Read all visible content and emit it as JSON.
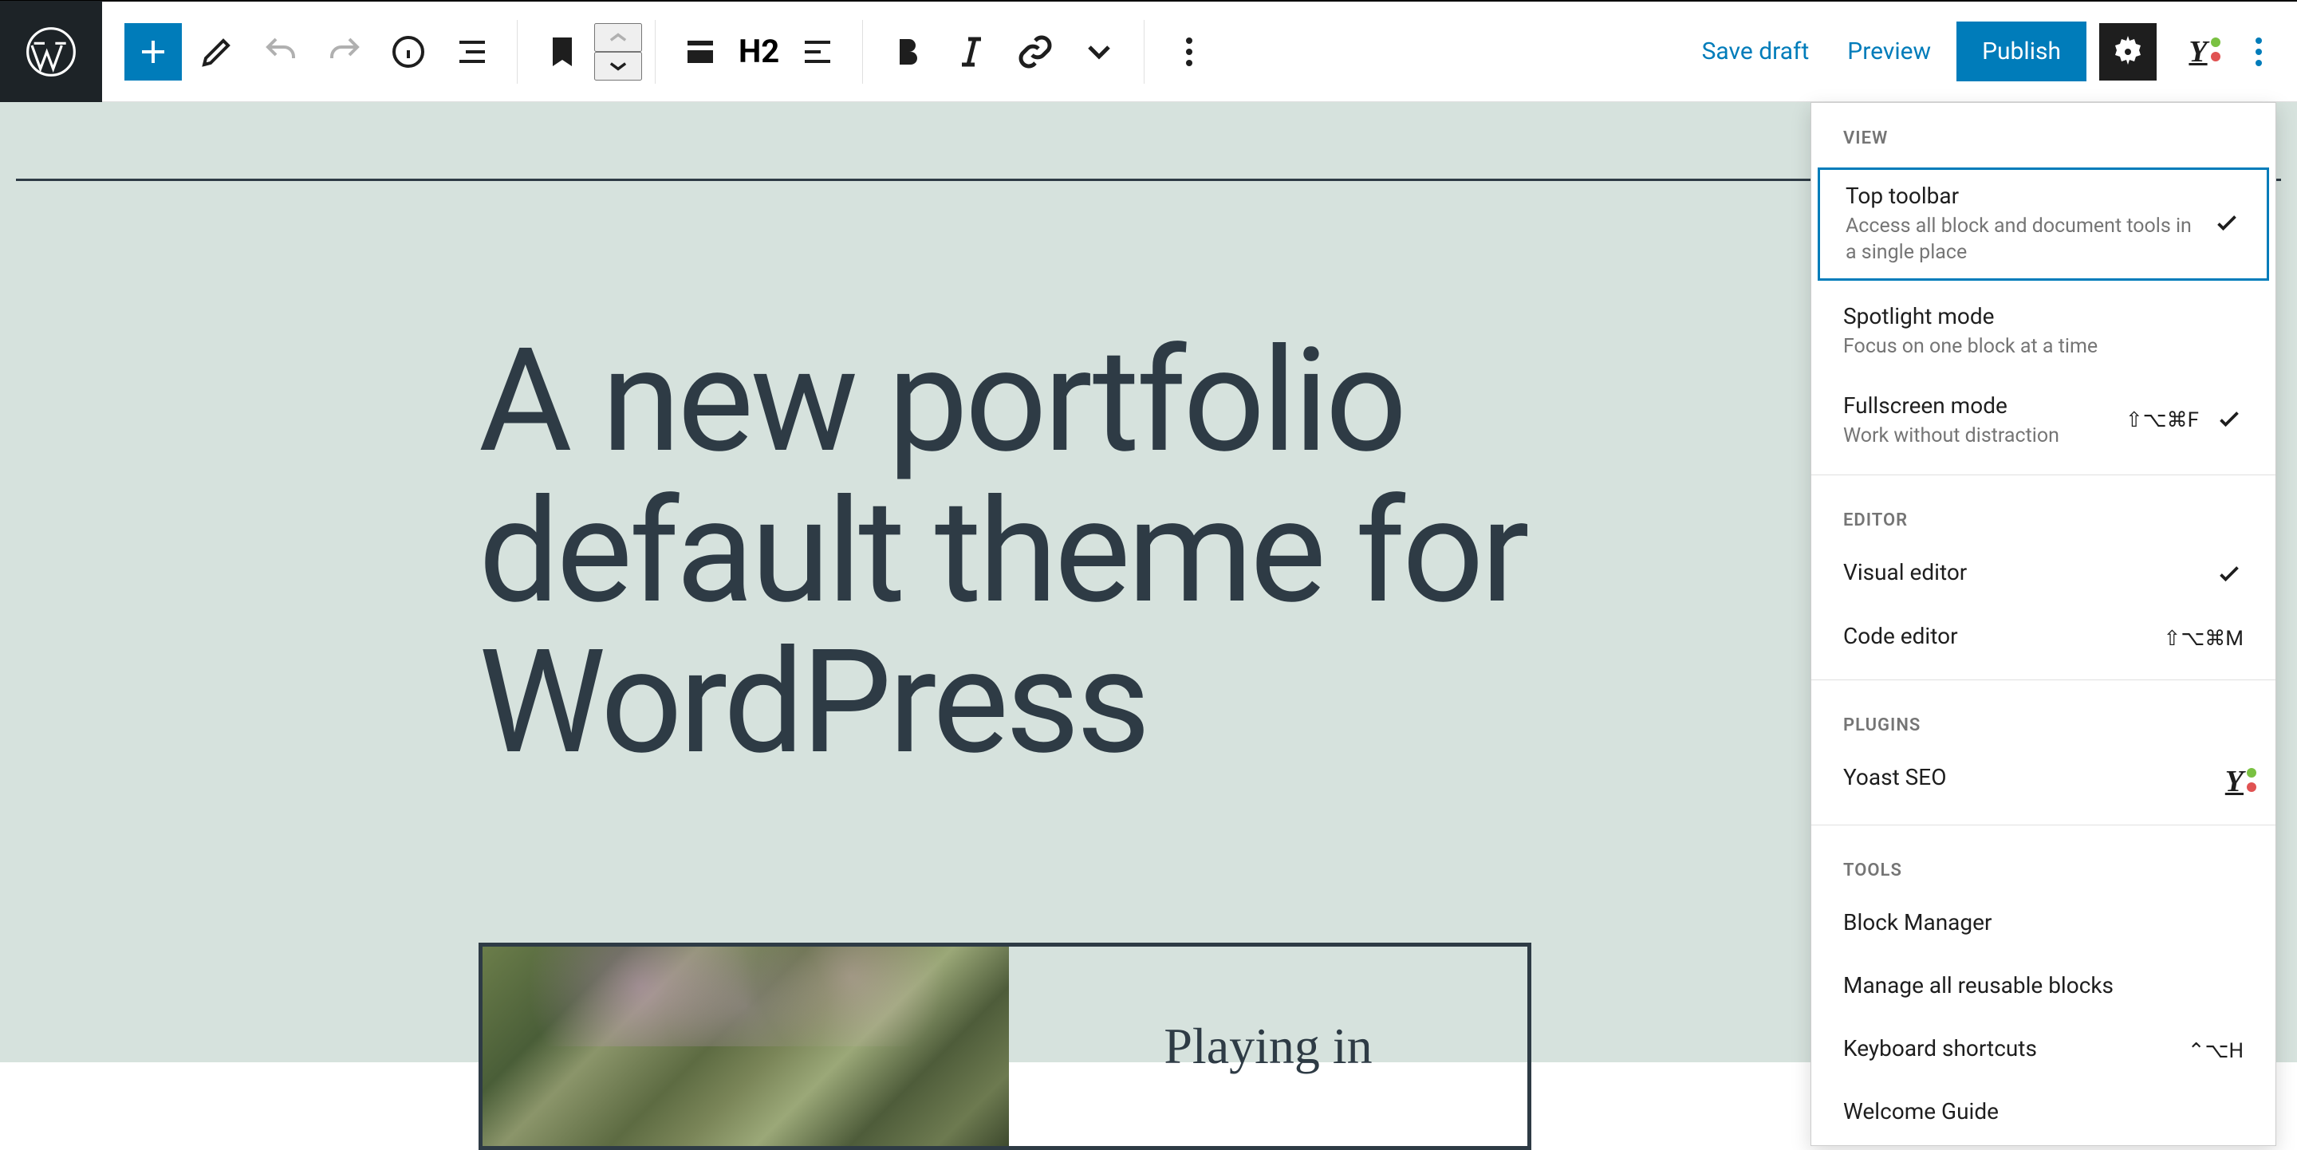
{
  "header": {
    "save_draft": "Save draft",
    "preview": "Preview",
    "publish": "Publish"
  },
  "block_toolbar": {
    "heading_level": "H2"
  },
  "canvas": {
    "title": "A new portfolio default theme for WordPress",
    "media_caption": "Playing in"
  },
  "dropdown": {
    "sections": {
      "view": {
        "label": "VIEW",
        "items": [
          {
            "title": "Top toolbar",
            "desc": "Access all block and document tools in a single place",
            "checked": true,
            "selected": true
          },
          {
            "title": "Spotlight mode",
            "desc": "Focus on one block at a time"
          },
          {
            "title": "Fullscreen mode",
            "desc": "Work without distraction",
            "shortcut": "⇧⌥⌘F",
            "checked": true
          }
        ]
      },
      "editor": {
        "label": "EDITOR",
        "items": [
          {
            "title": "Visual editor",
            "checked": true
          },
          {
            "title": "Code editor",
            "shortcut": "⇧⌥⌘M"
          }
        ]
      },
      "plugins": {
        "label": "PLUGINS",
        "items": [
          {
            "title": "Yoast SEO",
            "yoast": true
          }
        ]
      },
      "tools": {
        "label": "TOOLS",
        "items": [
          {
            "title": "Block Manager"
          },
          {
            "title": "Manage all reusable blocks"
          },
          {
            "title": "Keyboard shortcuts",
            "shortcut": "⌃⌥H"
          },
          {
            "title": "Welcome Guide"
          }
        ]
      }
    }
  }
}
